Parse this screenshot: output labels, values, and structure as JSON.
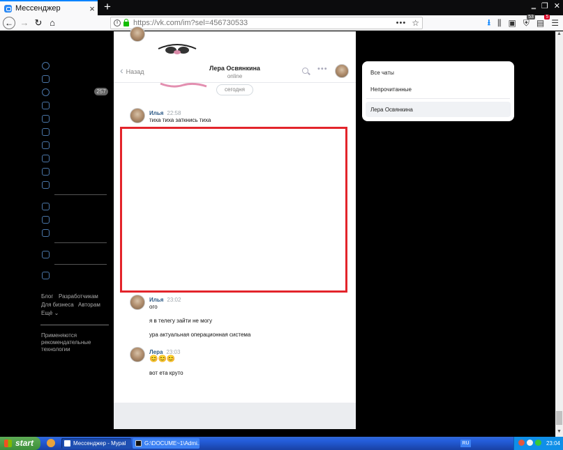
{
  "browser": {
    "tab_title": "Мессенджер",
    "tab_close": "×",
    "new_tab": "+",
    "url": "https://vk.com/im?sel=456730533",
    "window_controls": [
      "‗",
      "❐",
      "✕"
    ],
    "badges": {
      "extension": "53",
      "notifications": "5"
    }
  },
  "sidebar": {
    "messages_count": "257",
    "icons": [
      "profile-icon",
      "news-icon",
      "messages-icon",
      "friends-icon",
      "communities-icon",
      "photos-icon",
      "music-icon",
      "videos-icon",
      "games-icon",
      "market-icon",
      "apps-icon",
      "bookmarks-icon",
      "documents-icon",
      "community-icon",
      "services-icon"
    ],
    "footer_links": {
      "blog": "Блог",
      "developers": "Разработчикам",
      "business": "Для бизнеса",
      "authors": "Авторам",
      "more": "Ещё ⌄"
    },
    "recommend_note": "Применяются рекомендательные технологии"
  },
  "chat": {
    "back_label": "Назад",
    "contact_name": "Лера Освянкина",
    "contact_status": "online",
    "date_divider": "сегодня",
    "messages": [
      {
        "author": "Илья",
        "time": "22:58",
        "lines": [
          "тиха тиха заткнись тиха"
        ]
      },
      {
        "author": "Илья",
        "time": "23:02",
        "lines": [
          "ого",
          "я в телегу зайти не могу",
          "ура актуальная операционная система"
        ]
      },
      {
        "author": "Лера",
        "time": "23:03",
        "lines": [
          "😊😊😊",
          "вот ета круто"
        ]
      }
    ]
  },
  "folders": {
    "all_chats": "Все чаты",
    "unread": "Непрочитанные",
    "selected_chat": "Лера Освянкина"
  },
  "taskbar": {
    "start_label": "start",
    "tasks": [
      "Мессенджер - Mypal",
      "G:\\DOCUME~1\\Admi..."
    ],
    "language": "RU",
    "clock": "23:04"
  }
}
